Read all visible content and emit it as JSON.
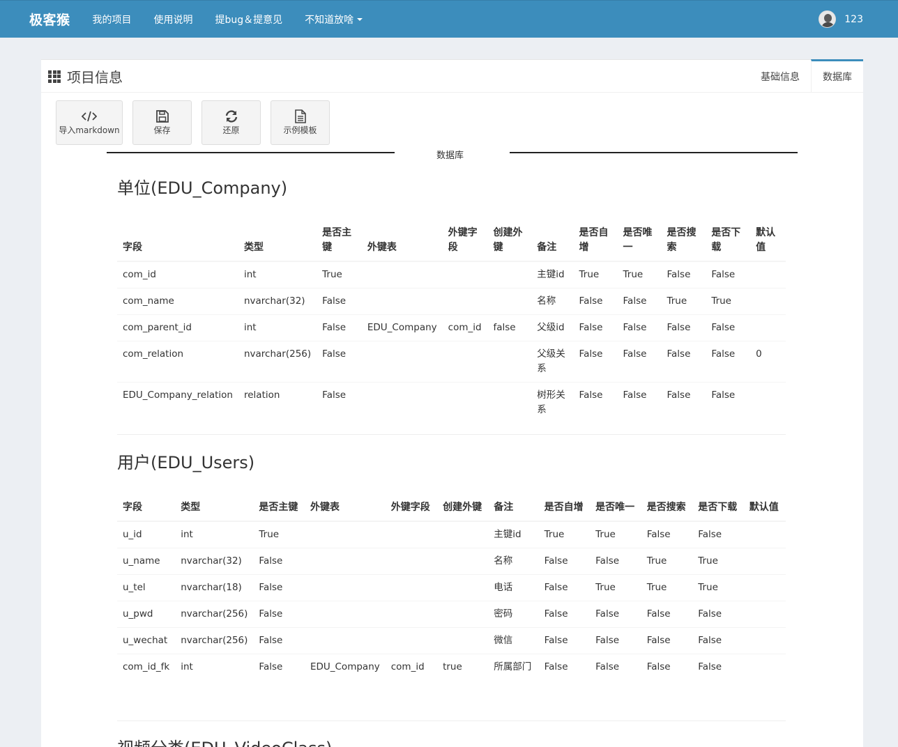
{
  "navbar": {
    "brand": "极客猴",
    "items": [
      "我的项目",
      "使用说明",
      "提bug＆提意见",
      "不知道放啥"
    ],
    "username": "123"
  },
  "box": {
    "title": "项目信息",
    "tabs": [
      "基础信息",
      "数据库"
    ],
    "active_tab": "数据库"
  },
  "toolbar": {
    "import_label": "导入markdown",
    "save_label": "保存",
    "restore_label": "还原",
    "template_label": "示例模板"
  },
  "divider_label": "数据库",
  "headers_company": [
    "字段",
    "类型",
    "是否主键",
    "外键表",
    "外键字段",
    "创建外键",
    "备注",
    "是否自增",
    "是否唯一",
    "是否搜索",
    "是否下载",
    "默认值"
  ],
  "company": {
    "title": "单位(EDU_Company)",
    "rows": [
      [
        "com_id",
        "int",
        "True",
        "",
        "",
        "",
        "主键id",
        "True",
        "True",
        "False",
        "False",
        ""
      ],
      [
        "com_name",
        "nvarchar(32)",
        "False",
        "",
        "",
        "",
        "名称",
        "False",
        "False",
        "True",
        "True",
        ""
      ],
      [
        "com_parent_id",
        "int",
        "False",
        "EDU_Company",
        "com_id",
        "false",
        "父级id",
        "False",
        "False",
        "False",
        "False",
        ""
      ],
      [
        "com_relation",
        "nvarchar(256)",
        "False",
        "",
        "",
        "",
        "父级关系",
        "False",
        "False",
        "False",
        "False",
        "0"
      ],
      [
        "EDU_Company_relation",
        "relation",
        "False",
        "",
        "",
        "",
        "树形关系",
        "False",
        "False",
        "False",
        "False",
        ""
      ]
    ]
  },
  "users": {
    "title": "用户(EDU_Users)",
    "rows": [
      [
        "u_id",
        "int",
        "True",
        "",
        "",
        "",
        "主键id",
        "True",
        "True",
        "False",
        "False",
        ""
      ],
      [
        "u_name",
        "nvarchar(32)",
        "False",
        "",
        "",
        "",
        "名称",
        "False",
        "False",
        "True",
        "True",
        ""
      ],
      [
        "u_tel",
        "nvarchar(18)",
        "False",
        "",
        "",
        "",
        "电话",
        "False",
        "True",
        "True",
        "True",
        ""
      ],
      [
        "u_pwd",
        "nvarchar(256)",
        "False",
        "",
        "",
        "",
        "密码",
        "False",
        "False",
        "False",
        "False",
        ""
      ],
      [
        "u_wechat",
        "nvarchar(256)",
        "False",
        "",
        "",
        "",
        "微信",
        "False",
        "False",
        "False",
        "False",
        ""
      ],
      [
        "com_id_fk",
        "int",
        "False",
        "EDU_Company",
        "com_id",
        "true",
        "所属部门",
        "False",
        "False",
        "False",
        "False",
        ""
      ]
    ]
  },
  "videoclass": {
    "title": "视频分类(EDU_VideoClass)"
  }
}
